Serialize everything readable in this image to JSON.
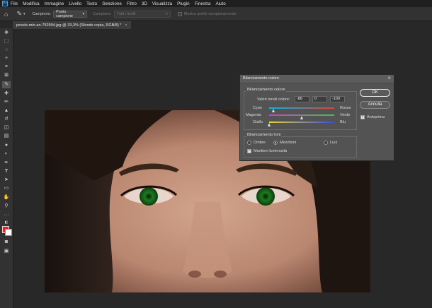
{
  "menubar": {
    "logo": "Ps",
    "items": [
      "File",
      "Modifica",
      "Immagine",
      "Livello",
      "Testo",
      "Selezione",
      "Filtro",
      "3D",
      "Visualizza",
      "Plugin",
      "Finestra",
      "Aiuto"
    ]
  },
  "options": {
    "sample_label": "Campione:",
    "sample_value": "Punto campione",
    "sample_all_label": "Campione:",
    "sample_all_value": "Tutti i livelli",
    "ring_label": "Mostra anello campionamento"
  },
  "document": {
    "tab_label": "pexels-min-an-792994.jpg @ 33,3% (Sfondo copia, RGB/8) *"
  },
  "dialog": {
    "title": "Bilanciamento colore",
    "close_glyph": "×",
    "group_balance": "Bilanciamento colore",
    "levels_label": "Valori tonali colore:",
    "levels": [
      "-86",
      "0",
      "-100"
    ],
    "sliders": [
      {
        "left": "Cyan",
        "right": "Rosso",
        "value": -86,
        "colors": [
          "#00b7e6",
          "#e0403a"
        ]
      },
      {
        "left": "Magenta",
        "right": "Verde",
        "value": 0,
        "colors": [
          "#d03bd0",
          "#3fc24a"
        ]
      },
      {
        "left": "Giallo",
        "right": "Blu",
        "value": -100,
        "colors": [
          "#e6d43a",
          "#3a4be0"
        ]
      }
    ],
    "group_tone": "Bilanciamento toni",
    "tones": [
      {
        "label": "Ombre",
        "selected": false
      },
      {
        "label": "Mezzitoni",
        "selected": true
      },
      {
        "label": "Luci",
        "selected": false
      }
    ],
    "preserve_label": "Mantieni luminosità",
    "preserve_checked": true,
    "ok_label": "OK",
    "cancel_label": "Annulla",
    "preview_label": "Anteprima",
    "preview_checked": true
  },
  "colors": {
    "foreground": "#e3232b",
    "background": "#ffffff",
    "accent": "#31a8ff"
  },
  "toolbar_icons": [
    "move-icon",
    "marquee-icon",
    "lasso-icon",
    "quick-select-icon",
    "crop-icon",
    "frame-icon",
    "eyedropper-icon",
    "healing-icon",
    "brush-icon",
    "stamp-icon",
    "history-brush-icon",
    "eraser-icon",
    "gradient-icon",
    "blur-icon",
    "dodge-icon",
    "pen-icon",
    "type-icon",
    "path-select-icon",
    "rectangle-icon",
    "hand-icon",
    "zoom-icon",
    "more-icon"
  ]
}
